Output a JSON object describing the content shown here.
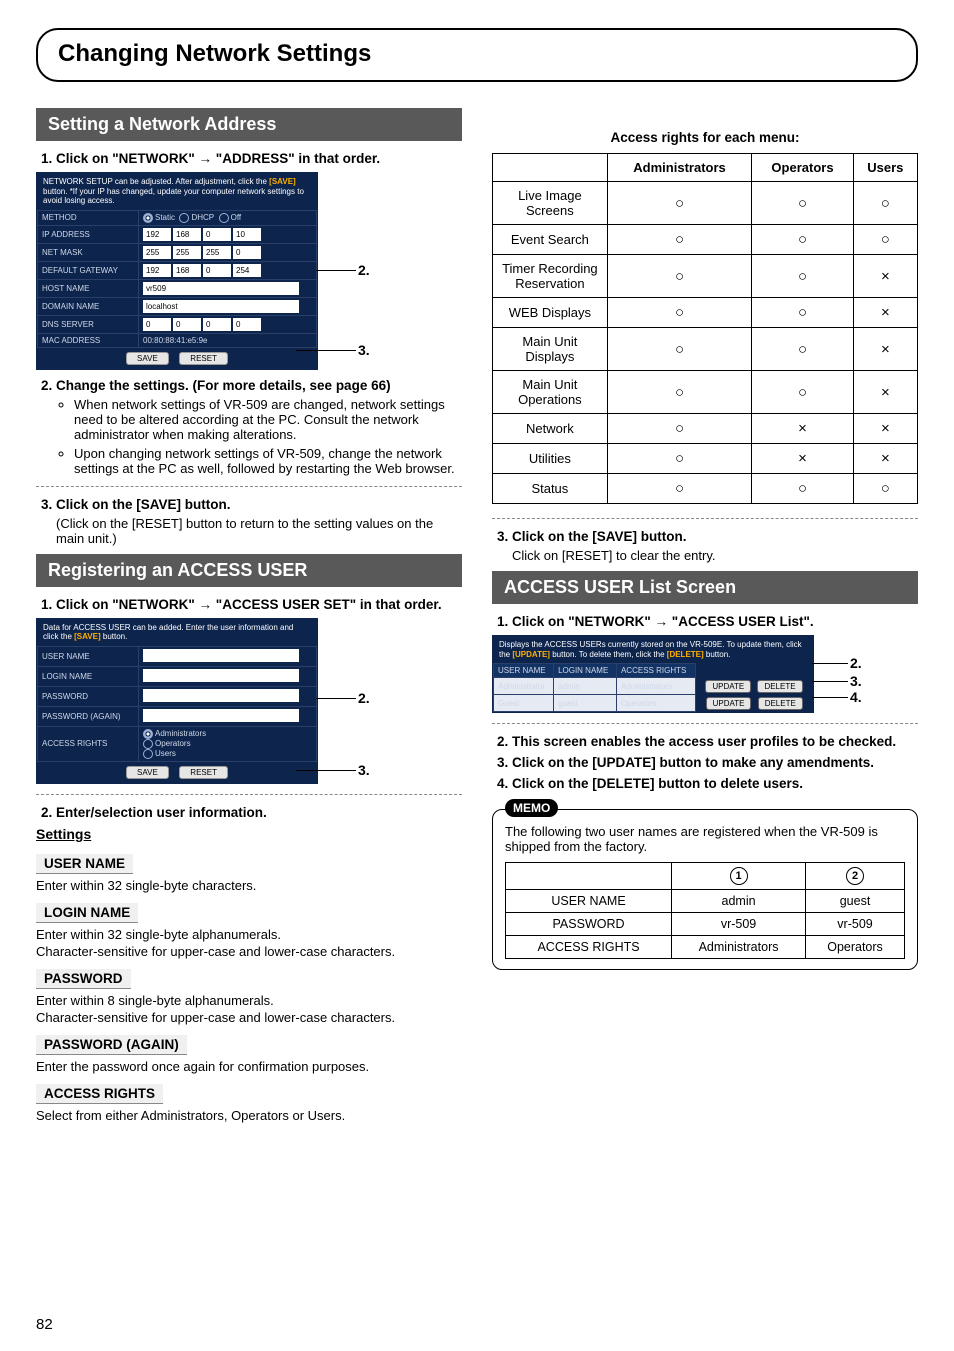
{
  "page_number": "82",
  "title": "Changing Network Settings",
  "left": {
    "section1_header": "Setting a Network Address",
    "step1": "Click on \"NETWORK\" → \"ADDRESS\" in that order.",
    "shot1": {
      "banner_a": "NETWORK SETUP can be adjusted. After adjustment, click the ",
      "banner_save": "[SAVE]",
      "banner_b": " button. *If your IP has changed, update your computer network settings to avoid losing access.",
      "rows": {
        "method": "METHOD",
        "method_opts": [
          "Static",
          "DHCP",
          "Off"
        ],
        "ip": "IP ADDRESS",
        "ip_v": [
          "192",
          "168",
          "0",
          "10"
        ],
        "mask": "NET MASK",
        "mask_v": [
          "255",
          "255",
          "255",
          "0"
        ],
        "gw": "DEFAULT GATEWAY",
        "gw_v": [
          "192",
          "168",
          "0",
          "254"
        ],
        "host": "HOST NAME",
        "host_v": "vr509",
        "domain": "DOMAIN NAME",
        "domain_v": "localhost",
        "dns": "DNS SERVER",
        "dns_v": [
          "0",
          "0",
          "0",
          "0"
        ],
        "mac": "MAC ADDRESS",
        "mac_v": "00:80:88:41:e5:9e"
      },
      "save_btn": "SAVE",
      "reset_btn": "RESET"
    },
    "step2": "Change the settings. (For more details, see page 66)",
    "step2_b1": "When network settings of VR-509 are changed, network settings need to be altered according at the PC. Consult the network administrator when making alterations.",
    "step2_b2": "Upon changing network settings of VR-509, change the network settings at the PC as well, followed by restarting the Web browser.",
    "step3": "Click on the [SAVE] button.",
    "step3_sub": "(Click on the [RESET] button to return to the setting values on the main unit.)",
    "section2_header": "Registering an ACCESS USER",
    "r_step1": "Click on \"NETWORK\" → \"ACCESS USER SET\" in that order.",
    "shot2": {
      "banner_a": "Data for ACCESS USER can be added. Enter the user information and click the ",
      "banner_save": "[SAVE]",
      "banner_b": " button.",
      "rows": {
        "uname": "USER NAME",
        "login": "LOGIN NAME",
        "pass": "PASSWORD",
        "pass2": "PASSWORD (AGAIN)",
        "rights": "ACCESS RIGHTS",
        "rights_opts": [
          "Administrators",
          "Operators",
          "Users"
        ]
      },
      "save_btn": "SAVE",
      "reset_btn": "RESET"
    },
    "r_step2": "Enter/selection user information.",
    "settings_heading": "Settings",
    "fields": {
      "uname": "USER NAME",
      "uname_d": "Enter within 32 single-byte characters.",
      "login": "LOGIN NAME",
      "login_d1": "Enter within 32 single-byte alphanumerals.",
      "login_d2": "Character-sensitive for upper-case and lower-case characters.",
      "pass": "PASSWORD",
      "pass_d1": "Enter within 8 single-byte alphanumerals.",
      "pass_d2": "Character-sensitive for upper-case and lower-case characters.",
      "pass2": "PASSWORD (AGAIN)",
      "pass2_d": "Enter the password once again for confirmation purposes.",
      "rights": "ACCESS RIGHTS",
      "rights_d": "Select from either Administrators, Operators or Users."
    }
  },
  "right": {
    "rights_heading": "Access rights for each menu:",
    "rights_table": {
      "cols": [
        "",
        "Administrators",
        "Operators",
        "Users"
      ],
      "rows": [
        [
          "Live Image Screens",
          "○",
          "○",
          "○"
        ],
        [
          "Event Search",
          "○",
          "○",
          "○"
        ],
        [
          "Timer Recording Reservation",
          "○",
          "○",
          "×"
        ],
        [
          "WEB Displays",
          "○",
          "○",
          "×"
        ],
        [
          "Main Unit Displays",
          "○",
          "○",
          "×"
        ],
        [
          "Main Unit Operations",
          "○",
          "○",
          "×"
        ],
        [
          "Network",
          "○",
          "×",
          "×"
        ],
        [
          "Utilities",
          "○",
          "×",
          "×"
        ],
        [
          "Status",
          "○",
          "○",
          "○"
        ]
      ]
    },
    "step3": "Click on the [SAVE] button.",
    "step3_sub": "Click on [RESET] to clear the entry.",
    "section3_header": "ACCESS USER List Screen",
    "l_step1": "Click on \"NETWORK\" → \"ACCESS USER List\".",
    "shot3": {
      "banner_a": "Displays the ACCESS USERs currently stored on the VR-509E. To update them, click the ",
      "banner_upd": "[UPDATE]",
      "banner_b": " button. To delete them, click the ",
      "banner_del": "[DELETE]",
      "banner_c": " button.",
      "head": [
        "USER NAME",
        "LOGIN NAME",
        "ACCESS RIGHTS"
      ],
      "rows": [
        [
          "Administrator",
          "admin",
          "Administrators"
        ],
        [
          "Guest",
          "guest",
          "Operators"
        ]
      ],
      "update_btn": "UPDATE",
      "delete_btn": "DELETE"
    },
    "l_step2": "This screen enables the access user profiles to be checked.",
    "l_step3": "Click on the [UPDATE] button to make any amendments.",
    "l_step4": "Click on the [DELETE] button to delete users.",
    "memo_tag": "MEMO",
    "memo_text": "The following two user names are registered when the VR-509 is shipped from the factory.",
    "factory": {
      "rows": [
        [
          "USER NAME",
          "admin",
          "guest"
        ],
        [
          "PASSWORD",
          "vr-509",
          "vr-509"
        ],
        [
          "ACCESS RIGHTS",
          "Administrators",
          "Operators"
        ]
      ]
    }
  },
  "callouts": {
    "c2": "2.",
    "c3": "3.",
    "c4": "4."
  }
}
